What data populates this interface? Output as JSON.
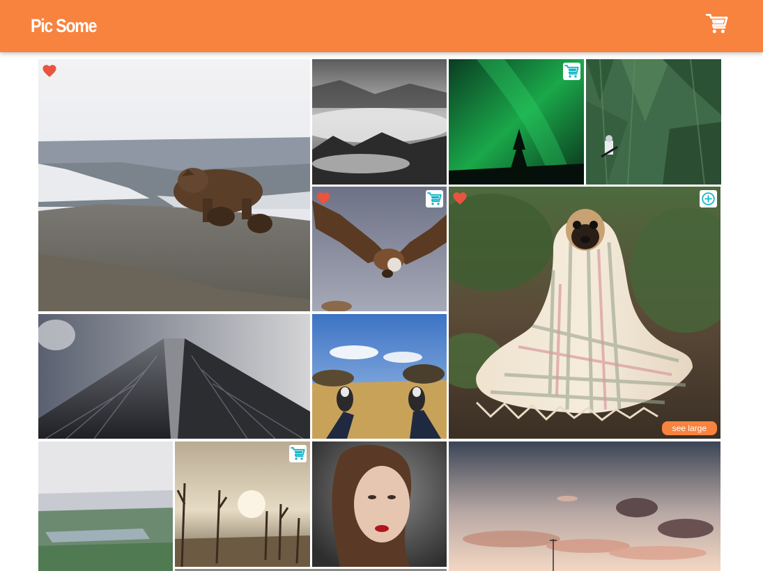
{
  "header": {
    "brand": "Pic Some",
    "cart_icon": "cart-icon",
    "color": "#f8833e"
  },
  "gallery": {
    "photos": [
      {
        "name": "bear-with-cubs",
        "favorited": true,
        "in_cart": false
      },
      {
        "name": "misty-forest",
        "favorited": false,
        "in_cart": false
      },
      {
        "name": "northern-lights",
        "favorited": false,
        "in_cart": true
      },
      {
        "name": "fir-trees-cyclist",
        "favorited": false,
        "in_cart": false
      },
      {
        "name": "vulture",
        "favorited": true,
        "in_cart": true
      },
      {
        "name": "pug-in-blanket",
        "favorited": true,
        "in_cart": false,
        "hover_action": "add-to-cart-icon",
        "see_large_label": "see large"
      },
      {
        "name": "skyscraper",
        "favorited": false,
        "in_cart": false
      },
      {
        "name": "sneakers-in-field",
        "favorited": false,
        "in_cart": false
      },
      {
        "name": "misty-city",
        "favorited": false,
        "in_cart": false
      },
      {
        "name": "dead-trees",
        "favorited": false,
        "in_cart": true
      },
      {
        "name": "woman-portrait",
        "favorited": false,
        "in_cart": false
      },
      {
        "name": "sunset-clouds",
        "favorited": false,
        "in_cart": false
      }
    ],
    "icons": {
      "favorite": "heart-icon",
      "in_cart": "cart-icon",
      "add": "add-circle-icon"
    },
    "colors": {
      "heart": "#e8543f",
      "cart_badge": "#14b4c8",
      "see_large_button": "#f8833e"
    }
  }
}
